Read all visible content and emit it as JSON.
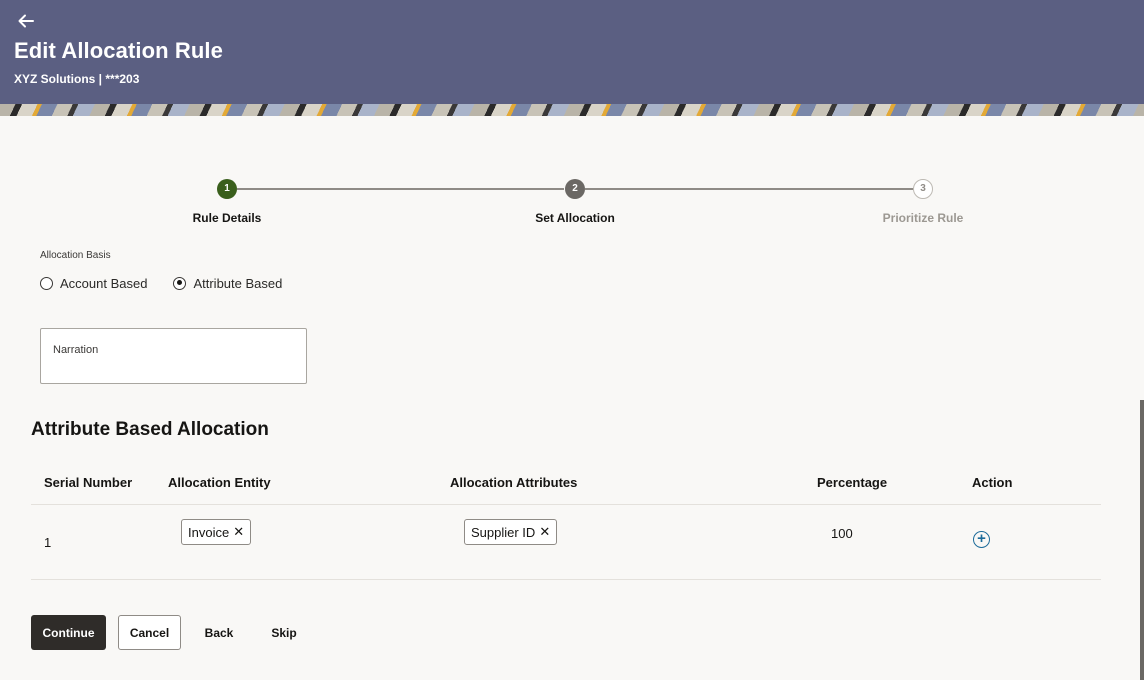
{
  "header": {
    "back_icon": "arrow-left-icon",
    "title": "Edit Allocation Rule",
    "subtitle": "XYZ Solutions | ***203",
    "background_color": "#5b5f82"
  },
  "stepper": {
    "steps": [
      {
        "number": "1",
        "label": "Rule Details",
        "state": "completed",
        "color": "#3a5f1c"
      },
      {
        "number": "2",
        "label": "Set Allocation",
        "state": "current",
        "color": "#6b6864"
      },
      {
        "number": "3",
        "label": "Prioritize Rule",
        "state": "upcoming",
        "color": "#bdb9b3"
      }
    ]
  },
  "allocation_basis": {
    "label": "Allocation Basis",
    "options": [
      {
        "label": "Account Based",
        "selected": false
      },
      {
        "label": "Attribute Based",
        "selected": true
      }
    ]
  },
  "narration": {
    "label": "Narration",
    "value": ""
  },
  "section": {
    "title": "Attribute Based Allocation"
  },
  "table": {
    "columns": [
      "Serial Number",
      "Allocation Entity",
      "Allocation Attributes",
      "Percentage",
      "Action"
    ],
    "rows": [
      {
        "serial": "1",
        "entity": "Invoice",
        "attribute": "Supplier ID",
        "percentage": "100",
        "action_icon": "add-circle-icon"
      }
    ]
  },
  "buttons": {
    "continue": "Continue",
    "cancel": "Cancel",
    "back": "Back",
    "skip": "Skip"
  }
}
